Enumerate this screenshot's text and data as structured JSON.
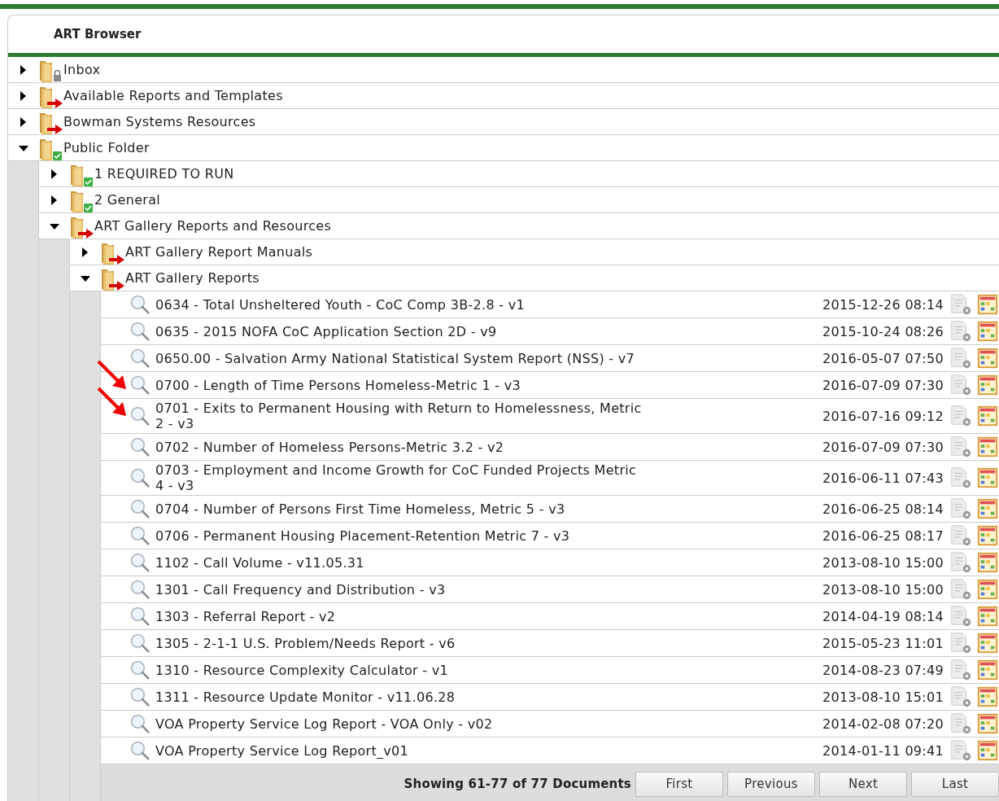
{
  "window": {
    "title": "ART Browser"
  },
  "tree": [
    {
      "label": "Inbox",
      "kind": "lock",
      "expanded": false
    },
    {
      "label": "Available Reports and Templates",
      "kind": "arrow",
      "expanded": false
    },
    {
      "label": "Bowman Systems Resources",
      "kind": "arrow",
      "expanded": false
    },
    {
      "label": "Public Folder",
      "kind": "check",
      "expanded": true,
      "children": [
        {
          "label": "1 REQUIRED TO RUN",
          "kind": "check",
          "expanded": false
        },
        {
          "label": "2 General",
          "kind": "check",
          "expanded": false
        },
        {
          "label": "ART Gallery Reports and Resources",
          "kind": "arrow",
          "expanded": true,
          "children": [
            {
              "label": "ART Gallery Report Manuals",
              "kind": "arrow",
              "expanded": false
            },
            {
              "label": "ART Gallery Reports",
              "kind": "arrow",
              "expanded": true,
              "documents": [
                {
                  "name": "0634 - Total Unsheltered Youth - CoC Comp 3B-2.8 - v1",
                  "date": "2015-12-26 08:14",
                  "marked": false
                },
                {
                  "name": "0635 - 2015 NOFA CoC Application Section 2D - v9",
                  "date": "2015-10-24 08:26",
                  "marked": false
                },
                {
                  "name": "0650.00 - Salvation Army National Statistical System Report (NSS) - v7",
                  "date": "2016-05-07 07:50",
                  "marked": false
                },
                {
                  "name": "0700 - Length of Time Persons Homeless-Metric 1 - v3",
                  "date": "2016-07-09 07:30",
                  "marked": true
                },
                {
                  "name": "0701 - Exits to Permanent Housing with Return to Homelessness, Metric 2 - v3",
                  "date": "2016-07-16 09:12",
                  "marked": true
                },
                {
                  "name": "0702 - Number of Homeless Persons-Metric 3.2 - v2",
                  "date": "2016-07-09 07:30",
                  "marked": false
                },
                {
                  "name": "0703 - Employment and Income Growth for CoC Funded Projects Metric 4 - v3",
                  "date": "2016-06-11 07:43",
                  "marked": false
                },
                {
                  "name": "0704 - Number of Persons First Time Homeless, Metric 5 - v3",
                  "date": "2016-06-25 08:14",
                  "marked": false
                },
                {
                  "name": "0706 - Permanent Housing Placement-Retention Metric 7 - v3",
                  "date": "2016-06-25 08:17",
                  "marked": false
                },
                {
                  "name": "1102 - Call Volume - v11.05.31",
                  "date": "2013-08-10 15:00",
                  "marked": false
                },
                {
                  "name": "1301 - Call Frequency and Distribution - v3",
                  "date": "2013-08-10 15:00",
                  "marked": false
                },
                {
                  "name": "1303 - Referral Report - v2",
                  "date": "2014-04-19 08:14",
                  "marked": false
                },
                {
                  "name": "1305 - 2-1-1 U.S. Problem/Needs Report - v6",
                  "date": "2015-05-23 11:01",
                  "marked": false
                },
                {
                  "name": "1310 - Resource Complexity Calculator - v1",
                  "date": "2014-08-23 07:49",
                  "marked": false
                },
                {
                  "name": "1311 - Resource Update Monitor - v11.06.28",
                  "date": "2013-08-10 15:01",
                  "marked": false
                },
                {
                  "name": "VOA Property Service Log Report - VOA Only - v02",
                  "date": "2014-02-08 07:20",
                  "marked": false
                },
                {
                  "name": "VOA Property Service Log Report_v01",
                  "date": "2014-01-11 09:41",
                  "marked": false
                }
              ],
              "pager": {
                "summary": "Showing 61-77 of 77 Documents",
                "buttons": [
                  "First",
                  "Previous",
                  "Next",
                  "Last"
                ]
              }
            }
          ]
        }
      ]
    }
  ]
}
